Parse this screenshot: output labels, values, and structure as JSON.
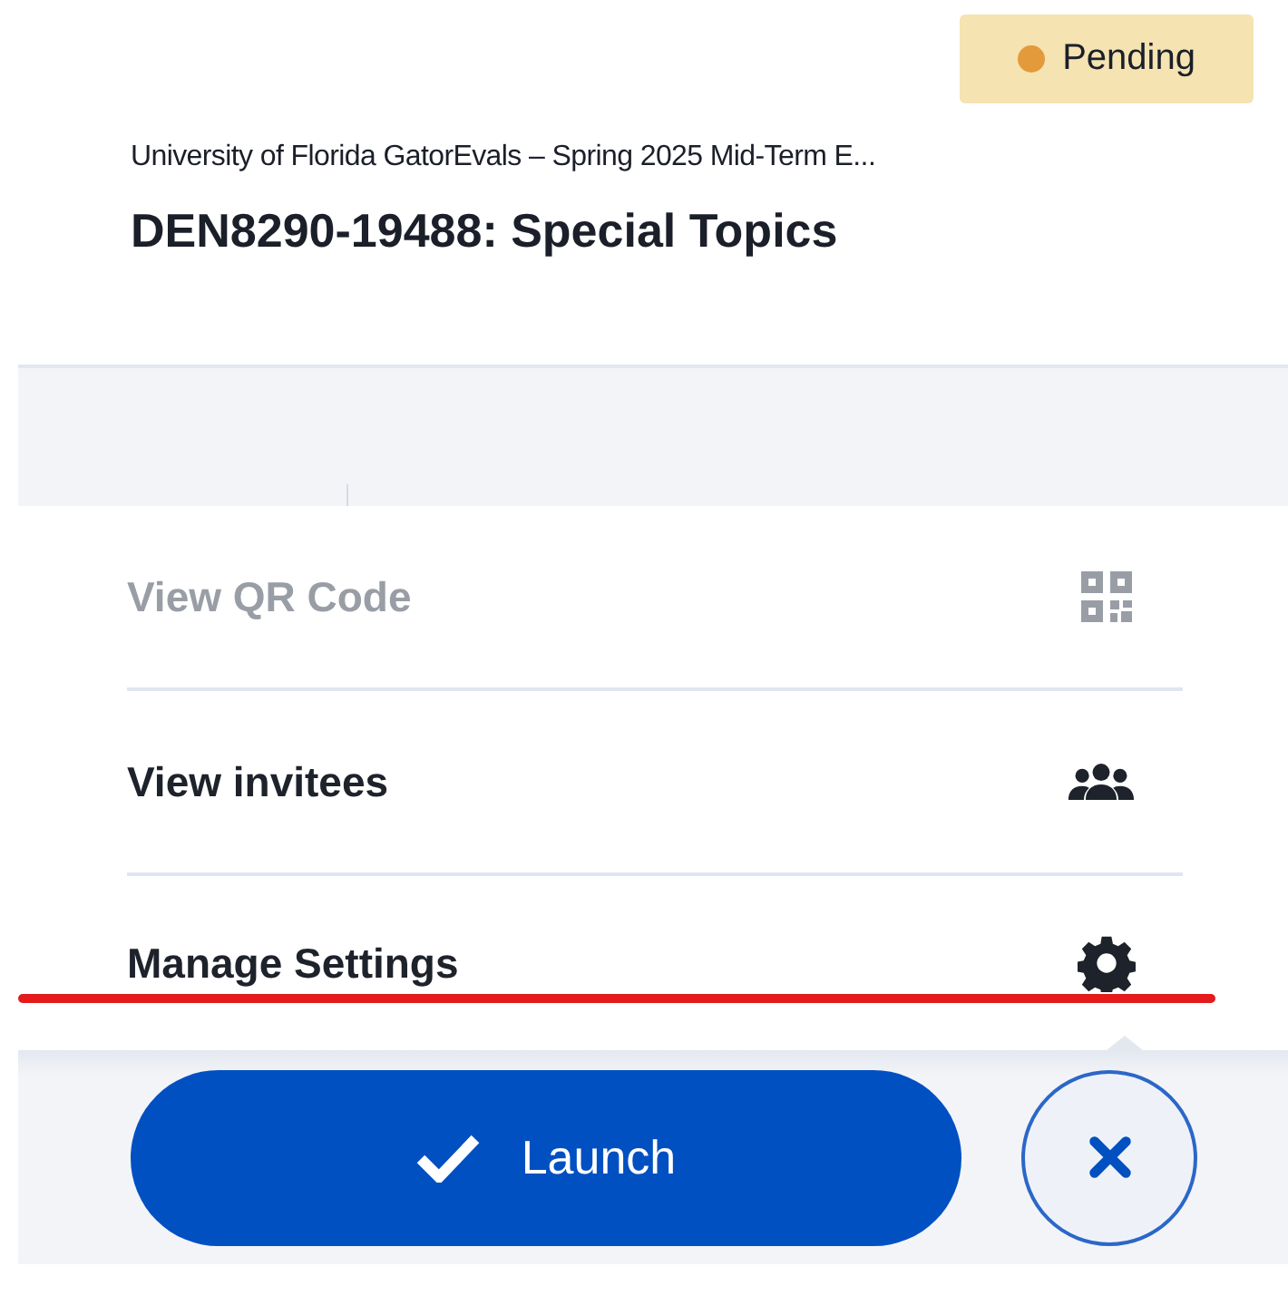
{
  "status_badge": {
    "label": "Pending",
    "color": "#e39a3b"
  },
  "evaluation": {
    "subtitle": "University of Florida GatorEvals – Spring 2025 Mid-Term E...",
    "title": "DEN8290-19488: Special Topics"
  },
  "menu": [
    {
      "label": "View QR Code",
      "kind": "qr",
      "disabled": true
    },
    {
      "label": "View invitees",
      "kind": "people",
      "disabled": false
    },
    {
      "label": "Manage Settings",
      "kind": "gear",
      "disabled": false,
      "underlined": true
    }
  ],
  "actions": {
    "primary": "Launch"
  }
}
